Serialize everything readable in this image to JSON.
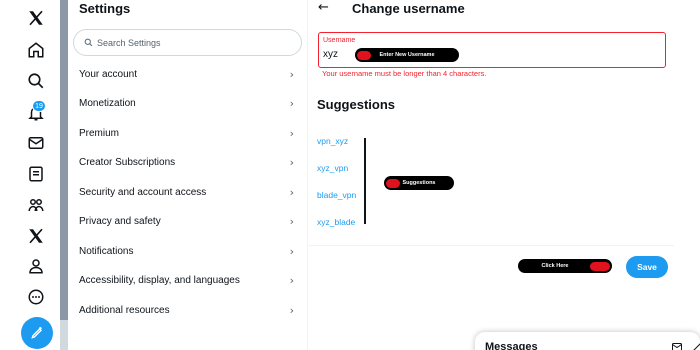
{
  "settings": {
    "title": "Settings",
    "search_placeholder": "Search Settings",
    "items": [
      {
        "label": "Your account"
      },
      {
        "label": "Monetization"
      },
      {
        "label": "Premium"
      },
      {
        "label": "Creator Subscriptions"
      },
      {
        "label": "Security and account access"
      },
      {
        "label": "Privacy and safety"
      },
      {
        "label": "Notifications"
      },
      {
        "label": "Accessibility, display, and languages"
      },
      {
        "label": "Additional resources"
      }
    ]
  },
  "nav": {
    "notification_count": "19",
    "icons": [
      "x-logo-icon",
      "home-icon",
      "search-icon",
      "notifications-icon",
      "messages-icon",
      "lists-icon",
      "communities-icon",
      "premium-x-icon",
      "profile-icon",
      "more-icon",
      "post-icon"
    ]
  },
  "main": {
    "back_glyph": "←",
    "heading": "Change username",
    "field_label": "Username",
    "field_value": "xyz",
    "error": "Your username must be longer than 4 characters.",
    "suggestions_title": "Suggestions",
    "suggestions": [
      "vpn_xyz",
      "xyz_vpn",
      "blade_vpn",
      "xyz_blade"
    ],
    "save_label": "Save"
  },
  "annotations": {
    "enter_username": "Enter New Username",
    "suggestions": "Suggestions",
    "click_here": "Click Here"
  },
  "messages": {
    "title": "Messages"
  },
  "colors": {
    "accent": "#1d9bf0",
    "error": "#f4212e",
    "annotation_red": "#e0121d"
  }
}
